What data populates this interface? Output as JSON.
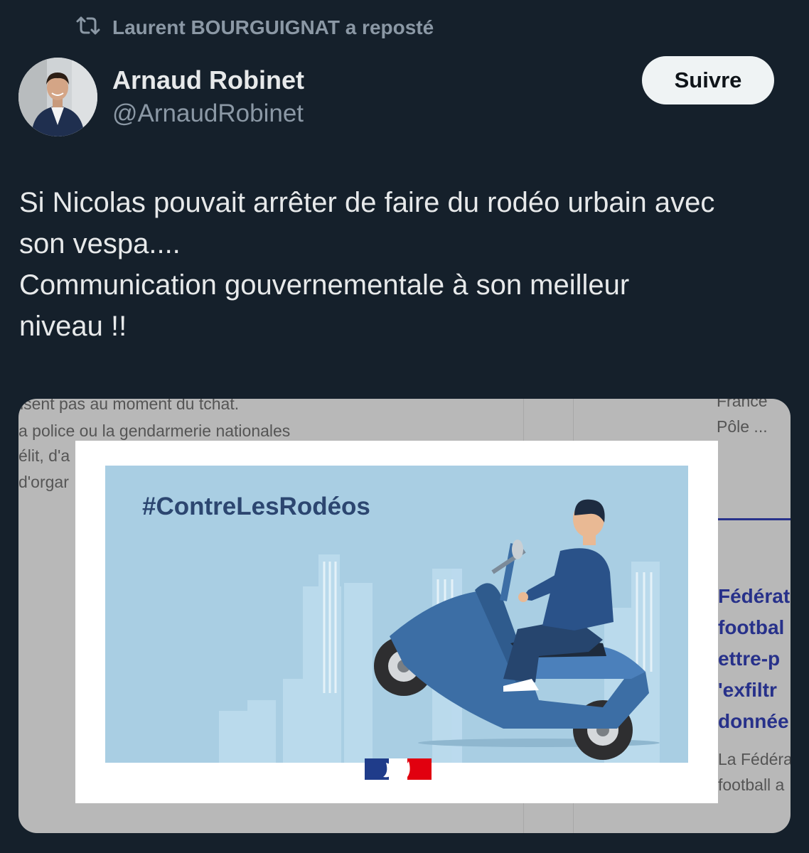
{
  "repost": {
    "icon": "repost-icon",
    "label": "Laurent BOURGUIGNAT a reposté"
  },
  "author": {
    "display_name": "Arnaud Robinet",
    "handle": "@ArnaudRobinet",
    "avatar_icon": "avatar"
  },
  "follow_button": {
    "label": "Suivre"
  },
  "tweet": {
    "lines": [
      "Si Nicolas pouvait arrêter de faire du rodéo urbain avec",
      "son vespa....",
      "Communication gouvernementale à son meilleur",
      "niveau !!"
    ]
  },
  "media": {
    "campaign_hashtag": "#ContreLesRodéos",
    "background_text_left": [
      "isent pas au moment du tchat.",
      "a police ou la gendarmerie nationales",
      "élit, d'a",
      "d'orgar"
    ],
    "background_text_right_top": [
      "France",
      "Pôle ..."
    ],
    "background_headline_right": [
      "Fédérat",
      "footbal",
      "ettre-p",
      "'exfiltr",
      "donnée"
    ],
    "background_text_right_bottom": [
      "La Fédéra",
      "football a"
    ],
    "colors": {
      "campaign_bg": "#a9cee3",
      "hashtag": "#2c4670",
      "scooter": "#3c6ea5",
      "flag_blue": "#1f3c8a",
      "flag_red": "#e1000f"
    }
  }
}
